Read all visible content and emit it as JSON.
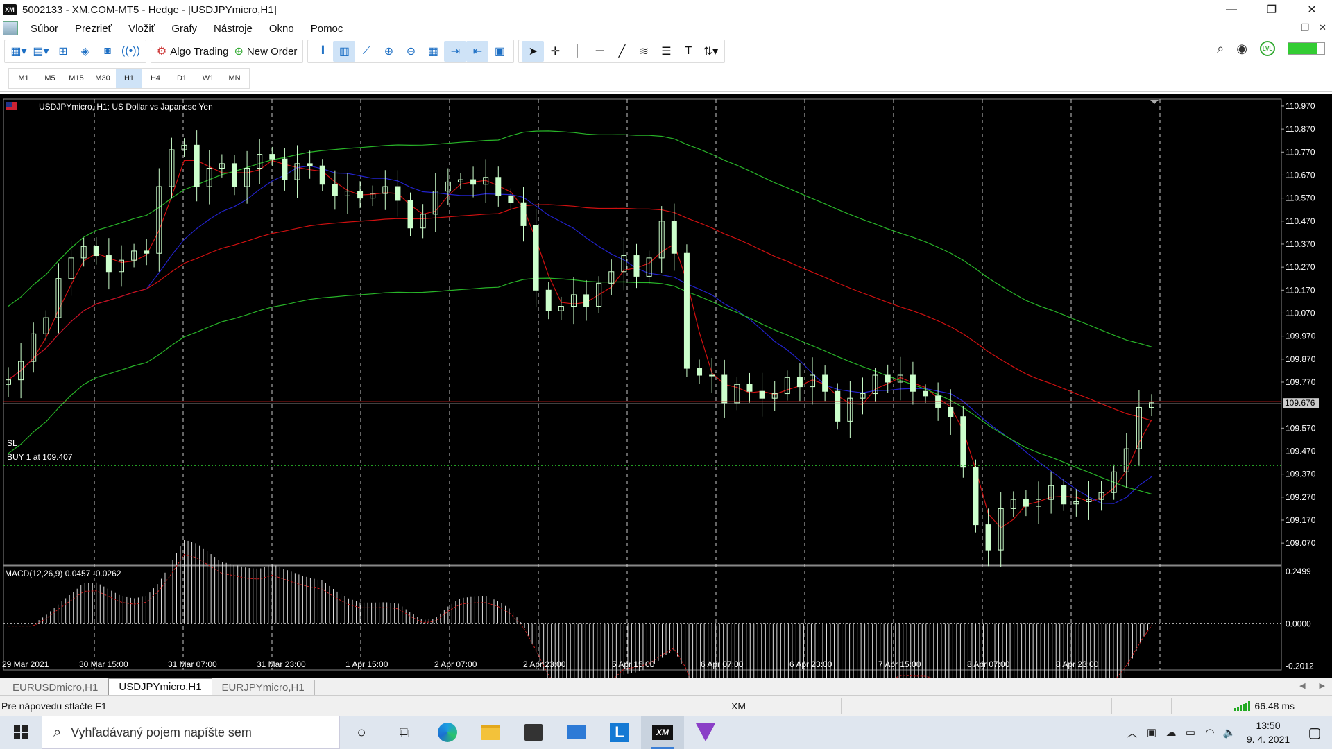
{
  "window": {
    "logo": "XM",
    "title": "5002133 - XM.COM-MT5 - Hedge - [USDJPYmicro,H1]",
    "controls": [
      "—",
      "❐",
      "✕"
    ],
    "mdi_controls": [
      "–",
      "❐",
      "✕"
    ]
  },
  "menu": {
    "items": [
      "Súbor",
      "Prezrieť",
      "Vložiť",
      "Grafy",
      "Nástroje",
      "Okno",
      "Pomoc"
    ]
  },
  "toolbar": {
    "algo_trading": "Algo Trading",
    "new_order": "New Order",
    "level_badge": "LVL",
    "signal_strength": 0.8
  },
  "timeframes": {
    "items": [
      "M1",
      "M5",
      "M15",
      "M30",
      "H1",
      "H4",
      "D1",
      "W1",
      "MN"
    ],
    "active": "H1"
  },
  "chart": {
    "header": "USDJPYmicro, H1:  US Dollar vs Japanese Yen",
    "sl_label": "SL",
    "position_label": "BUY 1 at 109.407",
    "current_price": "109.676",
    "macd_label": "MACD(12,26,9) 0.0457 -0.0262",
    "colors": {
      "bull": "#ccffcc",
      "bear": "#ccffcc",
      "ma_red": "#d01010",
      "ma_blue": "#2222cc",
      "ma_green": "#28b428",
      "grid": "#c8c8c8",
      "price_line": "#d02020"
    }
  },
  "chart_data": {
    "type": "candlestick",
    "symbol": "USDJPYmicro",
    "timeframe": "H1",
    "title": "USDJPYmicro, H1:  US Dollar vs Japanese Yen",
    "price_axis": {
      "ticks": [
        "110.970",
        "110.870",
        "110.770",
        "110.670",
        "110.570",
        "110.470",
        "110.370",
        "110.270",
        "110.170",
        "110.070",
        "109.970",
        "109.870",
        "109.770",
        "109.570",
        "109.470",
        "109.370",
        "109.270",
        "109.170",
        "109.070"
      ],
      "ylim": [
        108.98,
        111.0
      ]
    },
    "macd_axis": {
      "ticks": [
        "0.2499",
        "0.0000",
        "-0.2012"
      ],
      "ylim": [
        -0.22,
        0.27
      ]
    },
    "time_axis": {
      "ticks": [
        "29 Mar 2021",
        "30 Mar 15:00",
        "31 Mar 07:00",
        "31 Mar 23:00",
        "1 Apr 15:00",
        "2 Apr 07:00",
        "2 Apr 23:00",
        "5 Apr 15:00",
        "6 Apr 07:00",
        "6 Apr 23:00",
        "7 Apr 15:00",
        "8 Apr 07:00",
        "8 Apr 23:00"
      ]
    },
    "current_price": 109.676,
    "buy_entry": 109.407,
    "sl_level": 109.47,
    "close_path": [
      109.78,
      109.86,
      109.98,
      110.05,
      110.22,
      110.31,
      110.36,
      110.32,
      110.25,
      110.3,
      110.34,
      110.33,
      110.62,
      110.78,
      110.8,
      110.62,
      110.7,
      110.72,
      110.62,
      110.7,
      110.76,
      110.74,
      110.65,
      110.72,
      110.71,
      110.63,
      110.58,
      110.6,
      110.57,
      110.59,
      110.62,
      110.56,
      110.44,
      110.5,
      110.6,
      110.64,
      110.65,
      110.63,
      110.66,
      110.58,
      110.55,
      110.45,
      110.17,
      110.08,
      110.1,
      110.15,
      110.1,
      110.2,
      110.25,
      110.32,
      110.23,
      110.31,
      110.47,
      110.33,
      109.83,
      109.8,
      109.8,
      109.68,
      109.76,
      109.73,
      109.7,
      109.72,
      109.79,
      109.75,
      109.8,
      109.73,
      109.6,
      109.7,
      109.72,
      109.8,
      109.77,
      109.8,
      109.73,
      109.71,
      109.66,
      109.62,
      109.4,
      109.15,
      109.04,
      109.22,
      109.26,
      109.23,
      109.26,
      109.32,
      109.24,
      109.25,
      109.26,
      109.29,
      109.38,
      109.48,
      109.66,
      109.68
    ]
  },
  "tabs": {
    "items": [
      "EURUSDmicro,H1",
      "USDJPYmicro,H1",
      "EURJPYmicro,H1"
    ],
    "active": "USDJPYmicro,H1",
    "scroll": [
      "◀",
      "▶"
    ]
  },
  "status": {
    "help": "Pre nápovedu stlačte F1",
    "profile": "XM",
    "ping": "66.48 ms"
  },
  "taskbar": {
    "search_placeholder": "Vyhľadávaný pojem napíšte sem",
    "time": "13:50",
    "date": "9. 4. 2021",
    "l_app": "L",
    "xm_app": "XM"
  }
}
